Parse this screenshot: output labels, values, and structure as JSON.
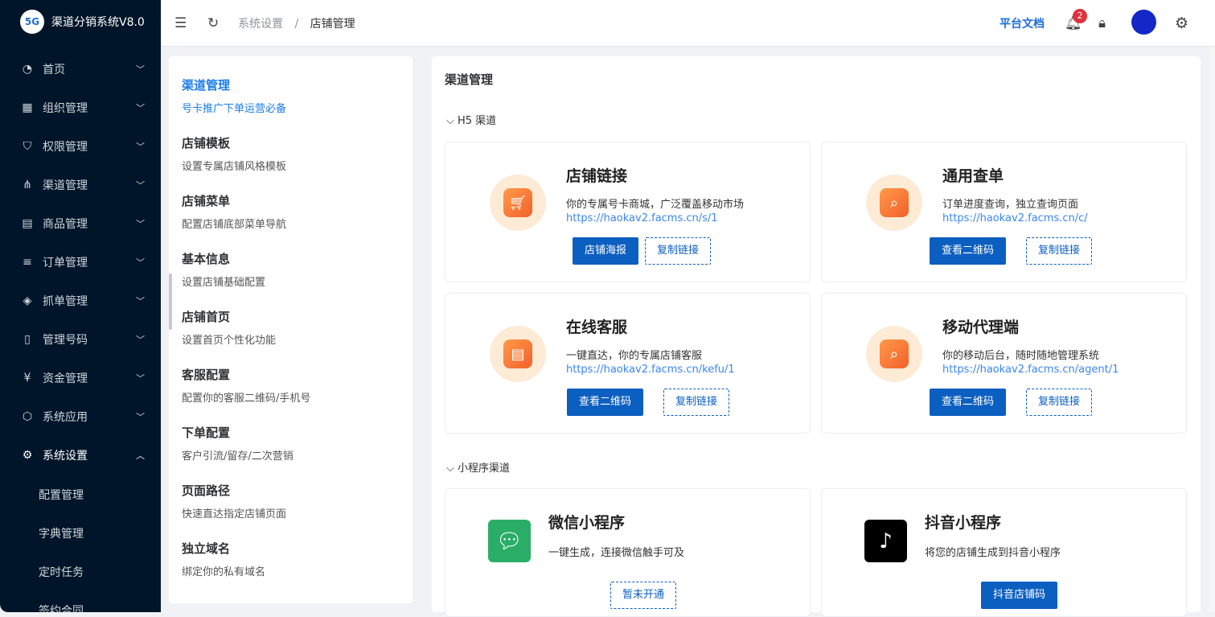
{
  "app": {
    "logo_text": "5G",
    "title": "渠道分销系统V8.0"
  },
  "sidebar": {
    "items": [
      {
        "label": "首页",
        "icon": "dashboard-icon"
      },
      {
        "label": "组织管理",
        "icon": "grid-icon"
      },
      {
        "label": "权限管理",
        "icon": "shield-icon"
      },
      {
        "label": "渠道管理",
        "icon": "share-nodes-icon"
      },
      {
        "label": "商品管理",
        "icon": "store-icon"
      },
      {
        "label": "订单管理",
        "icon": "list-icon"
      },
      {
        "label": "抓单管理",
        "icon": "diamond-icon"
      },
      {
        "label": "管理号码",
        "icon": "phone-icon"
      },
      {
        "label": "资金管理",
        "icon": "yuan-icon"
      },
      {
        "label": "系统应用",
        "icon": "cube-icon"
      },
      {
        "label": "系统设置",
        "icon": "gear-icon"
      }
    ],
    "sub_items": [
      "配置管理",
      "字典管理",
      "定时任务",
      "签约合同"
    ]
  },
  "header": {
    "breadcrumb": [
      "系统设置",
      "店铺管理"
    ],
    "separator": "/",
    "doc_link": "平台文档",
    "notification_count": "2"
  },
  "left_panel": {
    "items": [
      {
        "title": "渠道管理",
        "desc": "号卡推广下单运营必备"
      },
      {
        "title": "店铺模板",
        "desc": "设置专属店铺风格模板"
      },
      {
        "title": "店铺菜单",
        "desc": "配置店铺底部菜单导航"
      },
      {
        "title": "基本信息",
        "desc": "设置店铺基础配置"
      },
      {
        "title": "店铺首页",
        "desc": "设置首页个性化功能"
      },
      {
        "title": "客服配置",
        "desc": "配置你的客服二维码/手机号"
      },
      {
        "title": "下单配置",
        "desc": "客户引流/留存/二次营销"
      },
      {
        "title": "页面路径",
        "desc": "快速直达指定店铺页面"
      },
      {
        "title": "独立域名",
        "desc": "绑定你的私有域名"
      }
    ]
  },
  "main": {
    "title": "渠道管理",
    "sections": [
      {
        "label": "H5 渠道"
      },
      {
        "label": "小程序渠道"
      }
    ],
    "h5_cards": [
      {
        "title": "店铺链接",
        "desc": "你的专属号卡商城，广泛覆盖移动市场",
        "link": "https://haokav2.facms.cn/s/1",
        "primary": "店铺海报",
        "secondary": "复制链接"
      },
      {
        "title": "通用查单",
        "desc": "订单进度查询，独立查询页面",
        "link": "https://haokav2.facms.cn/c/",
        "primary": "查看二维码",
        "secondary": "复制链接"
      },
      {
        "title": "在线客服",
        "desc": "一键直达，你的专属店铺客服",
        "link": "https://haokav2.facms.cn/kefu/1",
        "primary": "查看二维码",
        "secondary": "复制链接"
      },
      {
        "title": "移动代理端",
        "desc": "你的移动后台，随时随地管理系统",
        "link": "https://haokav2.facms.cn/agent/1",
        "primary": "查看二维码",
        "secondary": "复制链接"
      }
    ],
    "mini_cards": [
      {
        "title": "微信小程序",
        "desc": "一键生成，连接微信触手可及",
        "button": "暂未开通"
      },
      {
        "title": "抖音小程序",
        "desc": "将您的店铺生成到抖音小程序",
        "button": "抖音店铺码"
      }
    ]
  },
  "colors": {
    "sidebar_bg": "#001529",
    "primary": "#0b5fc0",
    "link": "#3a86f0",
    "accent_orange": "#f3602a"
  }
}
